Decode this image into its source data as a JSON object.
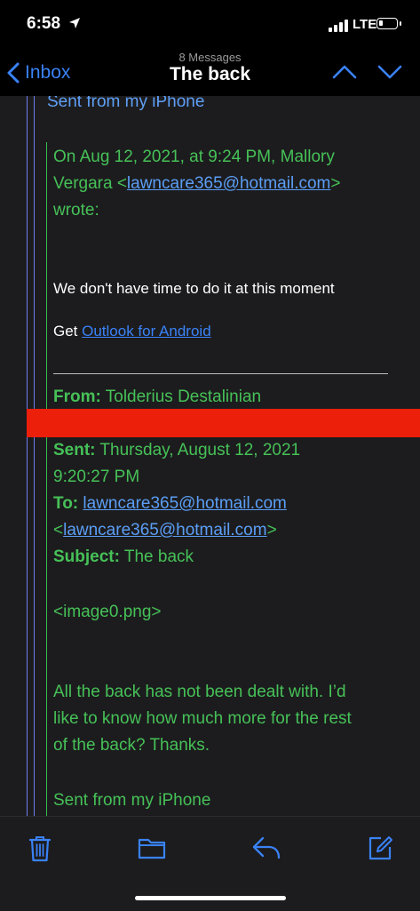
{
  "status": {
    "time": "6:58",
    "network": "LTE"
  },
  "nav": {
    "back_label": "Inbox",
    "message_count": "8 Messages",
    "title": "The back"
  },
  "message": {
    "top_sent": "Sent from my iPhone",
    "quote_intro_1": "On Aug 12, 2021, at 9:24 PM, Mallory",
    "quote_intro_2a": "Vergara <",
    "quote_intro_email": "lawncare365@hotmail.com",
    "quote_intro_2b": ">",
    "quote_intro_3": "wrote:",
    "body_line": "We don't have time to do it at this moment",
    "get_label": "Get ",
    "outlook_link": "Outlook for Android",
    "from_label": "From:",
    "from_value": " Tolderius Destalinian",
    "sent_label": "Sent:",
    "sent_value_1": " Thursday, August 12, 2021",
    "sent_value_2": "9:20:27 PM",
    "to_label": "To:",
    "to_email": "lawncare365@hotmail.com",
    "to_lt": "<",
    "to_email_2": "lawncare365@hotmail.com",
    "to_gt": ">",
    "subject_label": "Subject:",
    "subject_value": " The back",
    "attachment": "<image0.png>",
    "para_1": "All the back has not been dealt with. I’d",
    "para_2": "like to know how much more for the rest",
    "para_3": "of the back? Thanks.",
    "bottom_sent": "Sent from my iPhone"
  },
  "colors": {
    "accent": "#3a82f7",
    "quote_green": "#46c157",
    "redaction": "#ec1f0b"
  },
  "toolbar": {
    "icons": [
      "trash-icon",
      "folder-icon",
      "reply-icon",
      "compose-icon"
    ]
  }
}
